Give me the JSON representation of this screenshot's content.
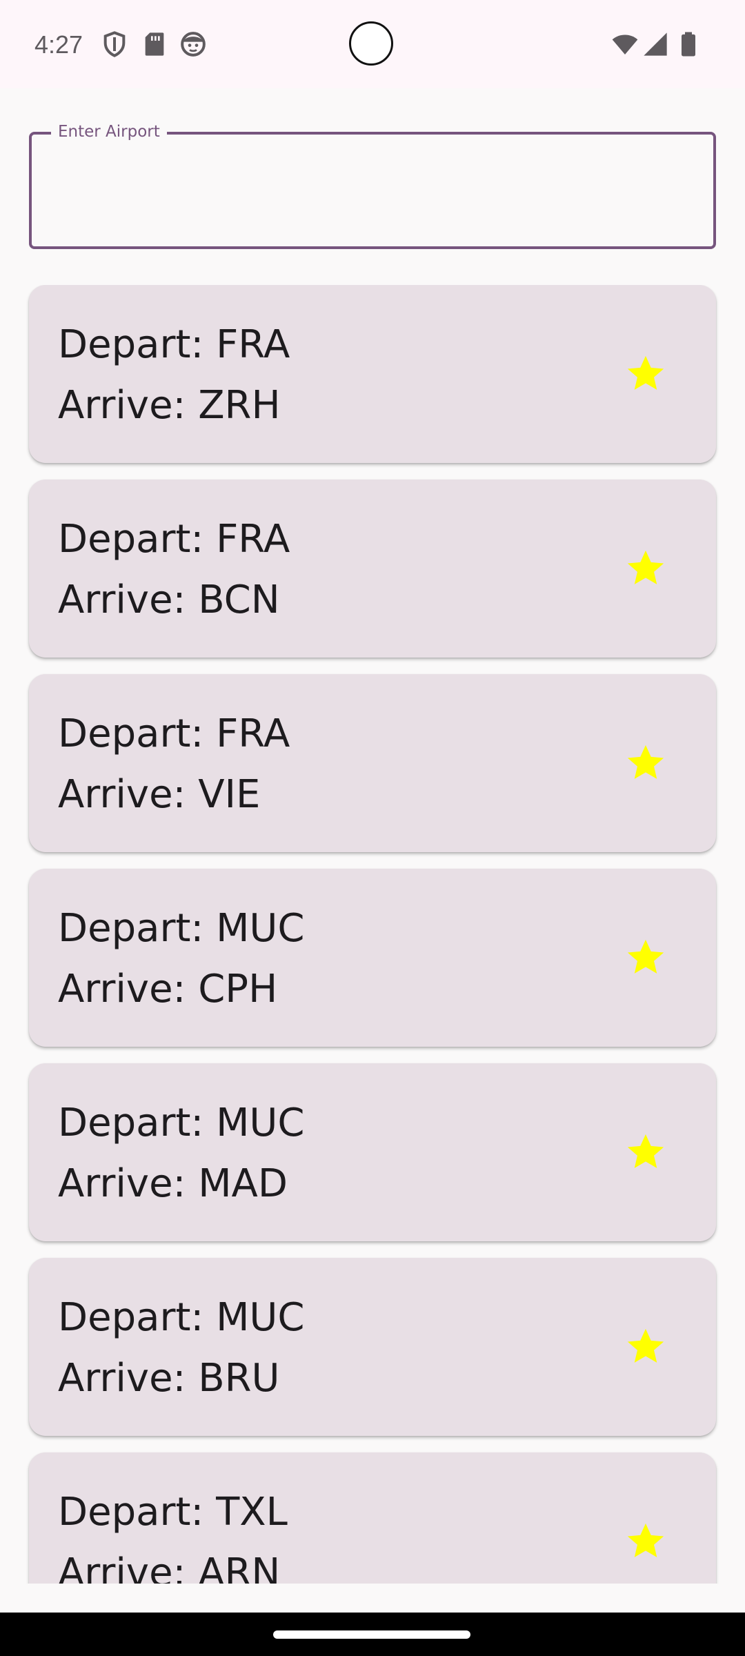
{
  "status_bar": {
    "time": "4:27",
    "left_icons": [
      "shield-icon",
      "sd-card-icon",
      "face-icon"
    ],
    "right_icons": [
      "wifi-icon",
      "signal-icon",
      "battery-icon"
    ]
  },
  "search": {
    "label": "Enter Airport",
    "value": "",
    "border_color": "#76557E"
  },
  "flights": [
    {
      "depart": "Depart: FRA",
      "arrive": "Arrive: ZRH",
      "favorite": true
    },
    {
      "depart": "Depart: FRA",
      "arrive": "Arrive: BCN",
      "favorite": true
    },
    {
      "depart": "Depart: FRA",
      "arrive": "Arrive: VIE",
      "favorite": true
    },
    {
      "depart": "Depart: MUC",
      "arrive": "Arrive: CPH",
      "favorite": true
    },
    {
      "depart": "Depart: MUC",
      "arrive": "Arrive: MAD",
      "favorite": true
    },
    {
      "depart": "Depart: MUC",
      "arrive": "Arrive: BRU",
      "favorite": true
    },
    {
      "depart": "Depart: TXL",
      "arrive": "Arrive: ARN",
      "favorite": true
    }
  ],
  "colors": {
    "card": "#E8DFE5",
    "star": "#FFFF00",
    "text": "#1D1B1E",
    "background": "#FAF9F9"
  }
}
